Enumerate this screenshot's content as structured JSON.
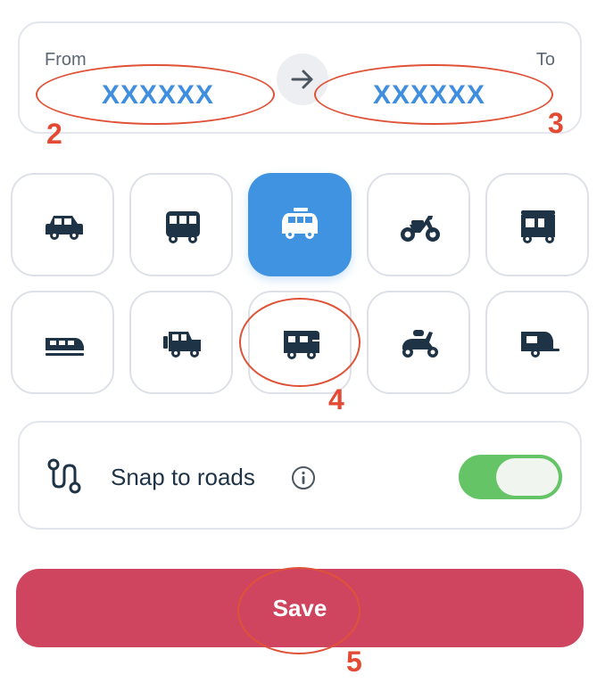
{
  "route": {
    "from_label": "From",
    "from_value": "XXXXXX",
    "to_label": "To",
    "to_value": "XXXXXX",
    "swap_icon": "arrow-right-icon"
  },
  "vehicles": [
    {
      "id": "car",
      "icon": "car-icon",
      "selected": false
    },
    {
      "id": "bus",
      "icon": "bus-icon",
      "selected": false
    },
    {
      "id": "van",
      "icon": "van-icon",
      "selected": true
    },
    {
      "id": "motorcycle",
      "icon": "motorcycle-icon",
      "selected": false
    },
    {
      "id": "tuk-tuk",
      "icon": "tuk-tuk-icon",
      "selected": false
    },
    {
      "id": "train",
      "icon": "train-icon",
      "selected": false
    },
    {
      "id": "jeep",
      "icon": "jeep-icon",
      "selected": false
    },
    {
      "id": "camper",
      "icon": "camper-icon",
      "selected": false
    },
    {
      "id": "scooter",
      "icon": "scooter-icon",
      "selected": false
    },
    {
      "id": "caravan",
      "icon": "caravan-icon",
      "selected": false
    }
  ],
  "snap": {
    "label": "Snap to roads",
    "enabled": true,
    "route_icon": "route-icon",
    "info_icon": "info-icon"
  },
  "save_label": "Save",
  "annotations": [
    "2",
    "3",
    "4",
    "5"
  ],
  "colors": {
    "accent": "#3f93e0",
    "save": "#cf4560",
    "toggle_on": "#64c466",
    "annotation": "#e24a33",
    "icon": "#1e3346"
  }
}
